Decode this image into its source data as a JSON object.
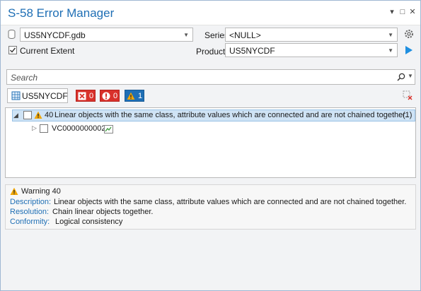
{
  "window": {
    "title": "S-58 Error Manager",
    "pin_glyph": "▾",
    "maximize_glyph": "□",
    "close_glyph": "✕"
  },
  "controls": {
    "database": {
      "value": "US5NYCDF.gdb"
    },
    "series": {
      "label": "Series",
      "value": "<NULL>"
    },
    "current_extent": {
      "label": "Current Extent",
      "checked": true
    },
    "product": {
      "label": "Product",
      "value": "US5NYCDF"
    },
    "settings_icon": "gear-icon",
    "run_icon": "play-icon"
  },
  "search": {
    "placeholder": "Search"
  },
  "product_tab": {
    "label": "US5NYCDF"
  },
  "filters": [
    {
      "name": "errors",
      "count": "0",
      "color": "#d9312b"
    },
    {
      "name": "critical",
      "count": "0",
      "color": "#d9312b"
    },
    {
      "name": "warnings",
      "count": "1",
      "color": "#1f6fb5"
    }
  ],
  "tree": {
    "group": {
      "code": "40",
      "text": "Linear objects with the same class, attribute values which are connected and are not chained together.",
      "count": "(1)"
    },
    "item": {
      "id": "VC0000000002"
    }
  },
  "details": {
    "header": "Warning 40",
    "description_label": "Description:",
    "description": "Linear objects with the same class, attribute values which are connected and are not chained together.",
    "resolution_label": "Resolution:",
    "resolution": "Chain linear objects together.",
    "conformity_label": "Conformity:",
    "conformity": "Logical consistency"
  },
  "colors": {
    "accent": "#1f6fb5",
    "error": "#d9312b",
    "warning": "#f0a500",
    "selection": "#cfe3f5"
  }
}
